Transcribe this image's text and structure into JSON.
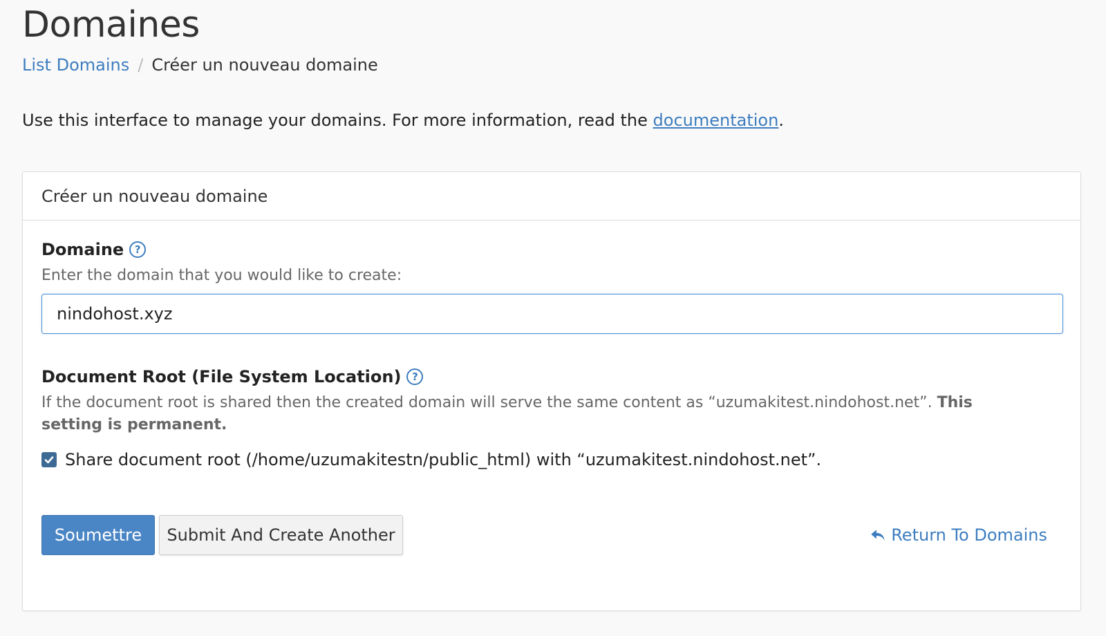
{
  "page": {
    "title": "Domaines"
  },
  "breadcrumb": {
    "parent": "List Domains",
    "separator": "/",
    "current": "Créer un nouveau domaine"
  },
  "intro": {
    "text": "Use this interface to manage your domains. For more information, read the ",
    "link": "documentation",
    "suffix": "."
  },
  "panel": {
    "heading": "Créer un nouveau domaine",
    "domain": {
      "label": "Domaine",
      "help_icon": "question-circle-icon",
      "hint": "Enter the domain that you would like to create:",
      "value": "nindohost.xyz"
    },
    "docroot": {
      "label": "Document Root (File System Location)",
      "help_icon": "question-circle-icon",
      "hint": "If the document root is shared then the created domain will serve the same content as “uzumakitest.nindohost.net”. ",
      "hint_bold": "This setting is permanent.",
      "checkbox_label": "Share document root (/home/uzumakitestn/public_html) with “uzumakitest.nindohost.net”.",
      "checked": true
    },
    "actions": {
      "submit": "Soumettre",
      "submit_another": "Submit And Create Another",
      "return": "Return To Domains",
      "return_icon": "reply-arrow-icon"
    }
  },
  "colors": {
    "accent": "#3d7dbf",
    "primary_button": "#4a86c5",
    "checkbox": "#3d6a94",
    "background": "#f9f9f9"
  }
}
